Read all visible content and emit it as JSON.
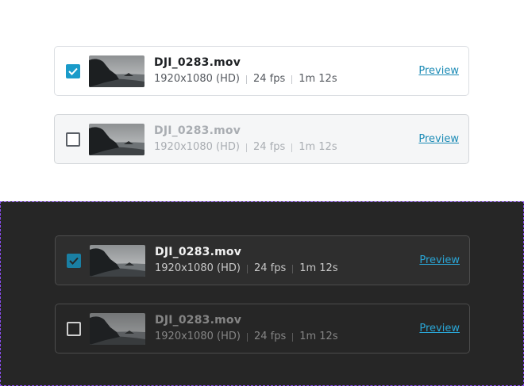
{
  "colors": {
    "accent": "#1a9bc9",
    "dark_background": "#262626",
    "dark_frame_border": "#8a4df0"
  },
  "cards": [
    {
      "theme": "light",
      "selected": true,
      "filename": "DJI_0283.mov",
      "resolution": "1920x1080 (HD)",
      "fps": "24 fps",
      "duration": "1m 12s",
      "preview_label": "Preview",
      "checkbox_icon": "checkmark-icon",
      "thumbnail": "coastal-rock-landscape"
    },
    {
      "theme": "light",
      "selected": false,
      "filename": "DJI_0283.mov",
      "resolution": "1920x1080 (HD)",
      "fps": "24 fps",
      "duration": "1m 12s",
      "preview_label": "Preview",
      "checkbox_icon": "none",
      "thumbnail": "coastal-rock-landscape"
    },
    {
      "theme": "dark",
      "selected": true,
      "filename": "DJI_0283.mov",
      "resolution": "1920x1080 (HD)",
      "fps": "24 fps",
      "duration": "1m 12s",
      "preview_label": "Preview",
      "checkbox_icon": "checkmark-icon",
      "thumbnail": "coastal-rock-landscape"
    },
    {
      "theme": "dark",
      "selected": false,
      "filename": "DJI_0283.mov",
      "resolution": "1920x1080 (HD)",
      "fps": "24 fps",
      "duration": "1m 12s",
      "preview_label": "Preview",
      "checkbox_icon": "none",
      "thumbnail": "coastal-rock-landscape"
    }
  ]
}
